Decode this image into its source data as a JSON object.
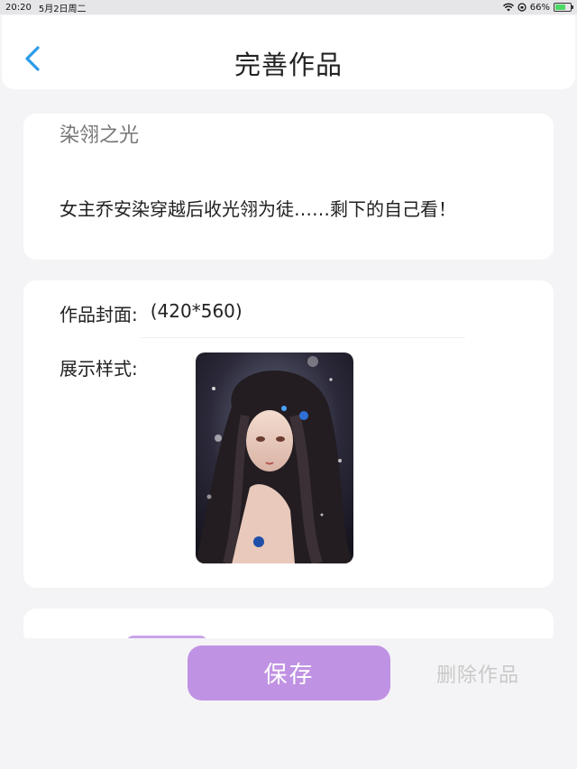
{
  "status_bar": {
    "time": "20:20",
    "date": "5月2日周二",
    "battery": "66%",
    "battery_level": 0.66
  },
  "header": {
    "title": "完善作品"
  },
  "work": {
    "title": "染翎之光",
    "description": "女主乔安染穿越后收光翎为徒……剩下的自己看！"
  },
  "cover": {
    "label": "作品封面:",
    "size": "(420*560)",
    "display_label": "展示样式:"
  },
  "actions": {
    "save": "保存",
    "delete": "删除作品"
  },
  "colors": {
    "accent": "#c092e3",
    "back_arrow": "#2a9be8",
    "delete_text": "#c9c9c9"
  }
}
